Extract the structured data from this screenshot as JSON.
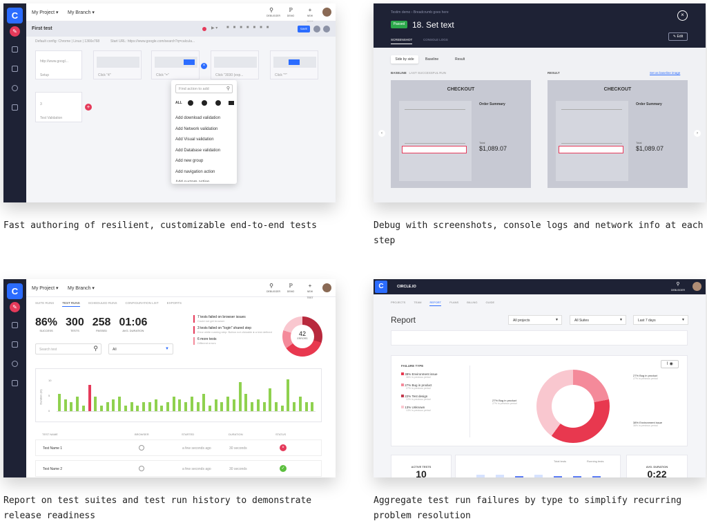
{
  "captions": [
    "Fast authoring of resilient, customizable end-to-end tests",
    "Debug with screenshots, console logs and network info at each step",
    "Report on test suites and test run history to demonstrate release readiness",
    "Aggregate test run failures by type to simplify recurring problem resolution"
  ],
  "common": {
    "logo": "C",
    "project": "My Project ▾",
    "branch": "My Branch ▾",
    "icons": [
      {
        "glyph": "⚲",
        "label": "DEBUGGER"
      },
      {
        "glyph": "ℙ",
        "label": "DEMO"
      },
      {
        "glyph": "+",
        "label": "NEW TEST"
      }
    ]
  },
  "authoring": {
    "test_title": "First test",
    "save": "SAVE",
    "config": "Default config: Chrome | Linux | 1366x768",
    "start_url": "Start URL: https://www.google.com/search?q=calcula...",
    "step1_value": "http://www.googl...",
    "step1_label": "Setup",
    "step2_label": "Click \"4\"",
    "step3_label": "Click \"=\"",
    "step4_label": "Click \"3030 (exp...",
    "step5_label": "Click \"*\"",
    "step6_value": "3",
    "step6_label": "Test Validation",
    "menu": {
      "search_placeholder": "Find action to add",
      "all": "ALL",
      "items": [
        "Add download validation",
        "Add Network validation",
        "Add Visual validation",
        "Add Database validation",
        "Add new group",
        "Add navigation action",
        "Add custom action"
      ]
    }
  },
  "debug": {
    "breadcrumb": "Testim demo › Breadcrumb goes here",
    "status": "Passed",
    "title": "18. Set text",
    "tabs": [
      "SCREENSHOT",
      "CONSOLE LOGS"
    ],
    "edit": "Edit",
    "modes": [
      "Side by side",
      "Baseline",
      "Result"
    ],
    "baseline_label": "BASELINE",
    "last_run": "LAST SUCCESSFUL RUN",
    "result_label": "RESULT",
    "set_baseline": "Set as baseline image",
    "checkout": "CHECKOUT",
    "order_summary": "Order Summary",
    "total_label": "Total",
    "total": "$1,089.07"
  },
  "reports": {
    "tabs": [
      "SUITE RUNS",
      "TEST RUNS",
      "SCHEDULED RUNS",
      "CONFIGURATION LIST",
      "EXPORTS"
    ],
    "stats": [
      {
        "value": "86%",
        "label": "SUCCESS"
      },
      {
        "value": "300",
        "label": "TESTS"
      },
      {
        "value": "258",
        "label": "PASSED"
      },
      {
        "value": "01:06",
        "label": "AVG. DURATION"
      }
    ],
    "alerts": [
      {
        "title": "7 tests failed on browser issues",
        "sub": "Could not get browser"
      },
      {
        "title": "3 tests failed on \"login\" shared step",
        "sub": "Error while running step: Button not clickable  ● a test defined"
      },
      {
        "title": "6 more tests",
        "sub": "Different errors"
      }
    ],
    "donut_value": "42",
    "donut_label": "ERRORS",
    "search_placeholder": "Search test",
    "filter": "All",
    "y_axis_label": "Duration (m)",
    "y_ticks": [
      "10",
      "5",
      "0"
    ],
    "bars": [
      6,
      4,
      3,
      5,
      2,
      9,
      5,
      2,
      3,
      4,
      5,
      2,
      3,
      2,
      3,
      3,
      4,
      2,
      3,
      5,
      4,
      3,
      5,
      3,
      6,
      2,
      4,
      3,
      5,
      4,
      10,
      6,
      3,
      4,
      3,
      8,
      3,
      2,
      11,
      3,
      5,
      3,
      3
    ],
    "bars_red_index": 5,
    "columns": [
      "TEST NAME",
      "BROWSER",
      "STARTED",
      "DURATION",
      "STATUS"
    ],
    "rows": [
      {
        "name": "Test Name 1",
        "started": "a few seconds ago",
        "duration": "30 seconds",
        "status": "failed"
      },
      {
        "name": "Test Name 2",
        "started": "a few seconds ago",
        "duration": "30 seconds",
        "status": "passed"
      }
    ]
  },
  "aggregate": {
    "brand": "CIRCLE.IO",
    "nav": [
      "PROJECTS",
      "TEAM",
      "REPORT",
      "PLANS",
      "BILLING",
      "GUIDE"
    ],
    "heading": "Report",
    "filters": [
      "All projects",
      "All Suites",
      "Last 7 days"
    ],
    "failure_title": "FAILURE TYPE",
    "failure_items": [
      {
        "title": "38% Environment issue",
        "sub": "36% in previous period",
        "color": "#e8384f"
      },
      {
        "title": "27% Bug in product",
        "sub": "27% in previous period",
        "color": "#f48a9a"
      },
      {
        "title": "22% Test design",
        "sub": "22% in previous period",
        "color": "#e8384f"
      },
      {
        "title": "13% Unknown",
        "sub": "13% in previous period",
        "color": "#f9c7cf"
      }
    ],
    "donut_labels": [
      {
        "title": "27% Bug in product",
        "sub": "27% in previous period"
      },
      {
        "title": "27% Bug in product",
        "sub": "27% in previous period"
      },
      {
        "title": "38% Environment issue",
        "sub": "36% in previous period"
      }
    ],
    "active_tests": "ACTIVE TESTS",
    "active_value": "10",
    "avg_duration": "AVG. DURATION",
    "avg_value": "0:22",
    "legend": [
      "Total tests",
      "Running tests"
    ]
  }
}
